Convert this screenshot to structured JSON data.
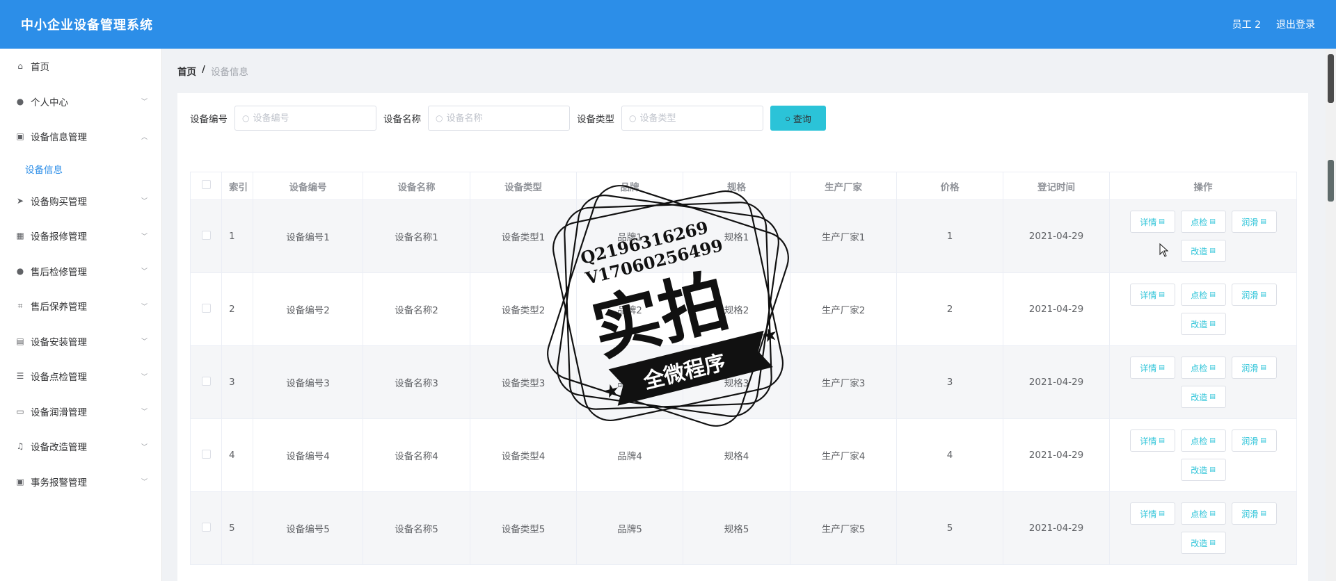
{
  "header": {
    "app_title": "中小企业设备管理系统",
    "user": "员工 2",
    "logout": "退出登录"
  },
  "sidebar": {
    "items": [
      {
        "label": "首页",
        "icon": "home-icon",
        "expanded": false,
        "has_sub": false
      },
      {
        "label": "个人中心",
        "icon": "user-icon",
        "expanded": false,
        "has_sub": true
      },
      {
        "label": "设备信息管理",
        "icon": "clipboard-icon",
        "expanded": true,
        "has_sub": true
      },
      {
        "label": "设备购买管理",
        "icon": "send-icon",
        "expanded": false,
        "has_sub": true
      },
      {
        "label": "设备报修管理",
        "icon": "grid-icon",
        "expanded": false,
        "has_sub": true
      },
      {
        "label": "售后检修管理",
        "icon": "user-icon",
        "expanded": false,
        "has_sub": true
      },
      {
        "label": "售后保养管理",
        "icon": "crop-icon",
        "expanded": false,
        "has_sub": true
      },
      {
        "label": "设备安装管理",
        "icon": "briefcase-icon",
        "expanded": false,
        "has_sub": true
      },
      {
        "label": "设备点检管理",
        "icon": "list-icon",
        "expanded": false,
        "has_sub": true
      },
      {
        "label": "设备润滑管理",
        "icon": "message-icon",
        "expanded": false,
        "has_sub": true
      },
      {
        "label": "设备改造管理",
        "icon": "bell-off-icon",
        "expanded": false,
        "has_sub": true
      },
      {
        "label": "事务报警管理",
        "icon": "clipboard-icon",
        "expanded": false,
        "has_sub": true
      }
    ],
    "sub_item": "设备信息"
  },
  "breadcrumb": {
    "home": "首页",
    "sep": "/",
    "current": "设备信息"
  },
  "search": {
    "fields": [
      {
        "label": "设备编号",
        "placeholder": "设备编号"
      },
      {
        "label": "设备名称",
        "placeholder": "设备名称"
      },
      {
        "label": "设备类型",
        "placeholder": "设备类型"
      }
    ],
    "button": "查询"
  },
  "table": {
    "columns": [
      "索引",
      "设备编号",
      "设备名称",
      "设备类型",
      "品牌",
      "规格",
      "生产厂家",
      "价格",
      "登记时间",
      "操作"
    ],
    "rows": [
      {
        "idx": "1",
        "code": "设备编号1",
        "name": "设备名称1",
        "type": "设备类型1",
        "brand": "品牌1",
        "spec": "规格1",
        "maker": "生产厂家1",
        "price": "1",
        "date": "2021-04-29"
      },
      {
        "idx": "2",
        "code": "设备编号2",
        "name": "设备名称2",
        "type": "设备类型2",
        "brand": "品牌2",
        "spec": "规格2",
        "maker": "生产厂家2",
        "price": "2",
        "date": "2021-04-29"
      },
      {
        "idx": "3",
        "code": "设备编号3",
        "name": "设备名称3",
        "type": "设备类型3",
        "brand": "品牌3",
        "spec": "规格3",
        "maker": "生产厂家3",
        "price": "3",
        "date": "2021-04-29"
      },
      {
        "idx": "4",
        "code": "设备编号4",
        "name": "设备名称4",
        "type": "设备类型4",
        "brand": "品牌4",
        "spec": "规格4",
        "maker": "生产厂家4",
        "price": "4",
        "date": "2021-04-29"
      },
      {
        "idx": "5",
        "code": "设备编号5",
        "name": "设备名称5",
        "type": "设备类型5",
        "brand": "品牌5",
        "spec": "规格5",
        "maker": "生产厂家5",
        "price": "5",
        "date": "2021-04-29"
      }
    ],
    "actions": [
      "详情",
      "点检",
      "润滑",
      "改造"
    ]
  },
  "stamp": {
    "line1": "Q2196316269",
    "line2": "V17060256499",
    "big": "实拍",
    "ribbon": "全微程序"
  },
  "colors": {
    "header": "#2c8ee8",
    "accent": "#2bc3d8"
  }
}
